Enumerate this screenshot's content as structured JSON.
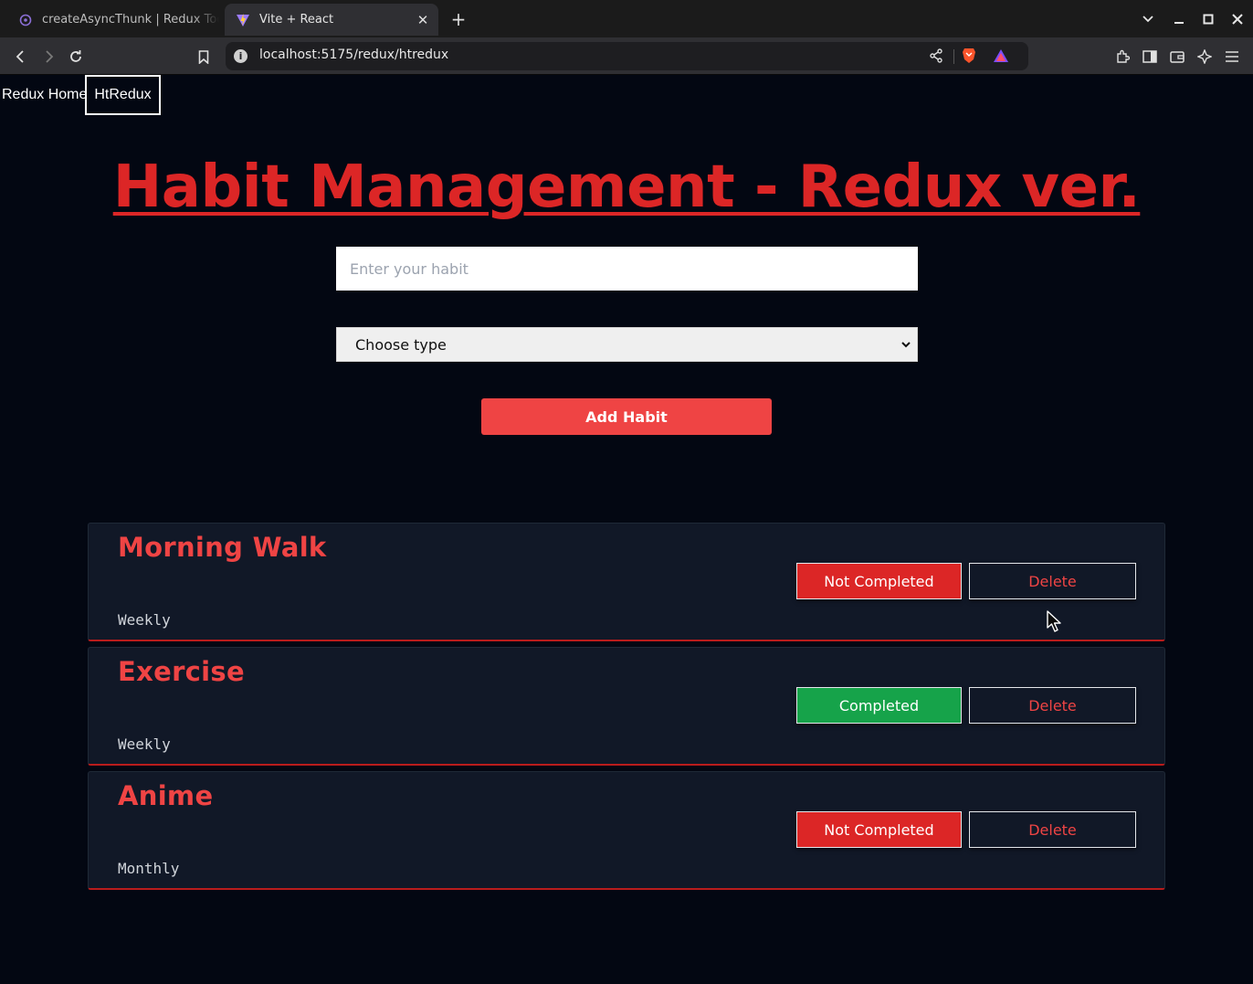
{
  "browser": {
    "tabs": [
      {
        "title": "createAsyncThunk | Redux Toolkit",
        "active": false
      },
      {
        "title": "Vite + React",
        "active": true
      }
    ],
    "url": "localhost:5175/redux/htredux"
  },
  "nav": {
    "home_label": "Redux Home",
    "current_label": "HtRedux"
  },
  "page": {
    "title": "Habit Management - Redux ver.",
    "input_placeholder": "Enter your habit",
    "select_value": "Choose type",
    "add_button": "Add Habit",
    "delete_label": "Delete"
  },
  "colors": {
    "accent_red": "#dc2626",
    "not_completed": "#dc2626",
    "completed": "#16a34a",
    "card_bg": "#111827",
    "page_bg": "#030712"
  },
  "habits": [
    {
      "name": "Morning Walk",
      "frequency": "Weekly",
      "status": "Not Completed",
      "status_color": "#dc2626"
    },
    {
      "name": "Exercise",
      "frequency": "Weekly",
      "status": "Completed",
      "status_color": "#16a34a"
    },
    {
      "name": "Anime",
      "frequency": "Monthly",
      "status": "Not Completed",
      "status_color": "#dc2626"
    }
  ]
}
